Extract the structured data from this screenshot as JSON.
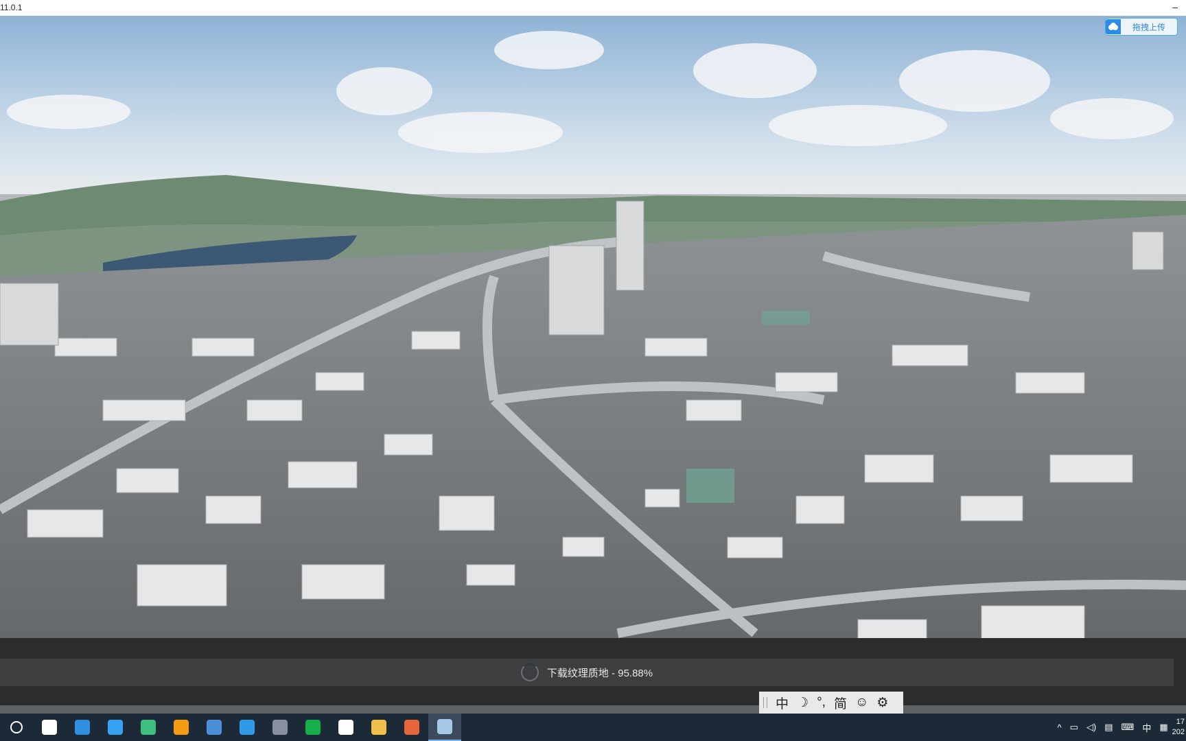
{
  "window": {
    "title": "11.0.1",
    "minimize_glyph": "–"
  },
  "upload_button": {
    "label": "拖拽上传",
    "icon": "cloud-upload-icon",
    "color": "#2b8be6"
  },
  "loading": {
    "text": "下载纹理质地 - 95.88%",
    "progress_percent": 95.88
  },
  "ime_toolbar": {
    "lang": "中",
    "moon": "☽",
    "punct": "°,",
    "simplified": "简",
    "emoji": "☺",
    "settings": "⚙"
  },
  "taskbar": {
    "apps": [
      {
        "name": "search-circle-icon",
        "color": "#ffffff"
      },
      {
        "name": "task-view-icon",
        "color": "#ffffff"
      },
      {
        "name": "edge-icon",
        "color": "#2f8fe0"
      },
      {
        "name": "qq-browser-icon",
        "color": "#36a3f2"
      },
      {
        "name": "unreal-icon",
        "color": "#3fbf7f"
      },
      {
        "name": "search-tool-icon",
        "color": "#f39c12"
      },
      {
        "name": "file-manager-icon",
        "color": "#4a8fd8"
      },
      {
        "name": "notes-icon",
        "color": "#2f9be8"
      },
      {
        "name": "calculator-icon",
        "color": "#8a8fa0"
      },
      {
        "name": "wps-sheet-icon",
        "color": "#16b04a"
      },
      {
        "name": "wechat-icon",
        "color": "#ffffff"
      },
      {
        "name": "folder-app-icon",
        "color": "#f0c04a"
      },
      {
        "name": "presentation-icon",
        "color": "#e8643a"
      },
      {
        "name": "cesium-app-icon",
        "color": "#a8c8e8"
      }
    ],
    "tray": {
      "caret": "^",
      "ime_lang": "中",
      "clock_time": "17",
      "clock_date": "202"
    }
  }
}
